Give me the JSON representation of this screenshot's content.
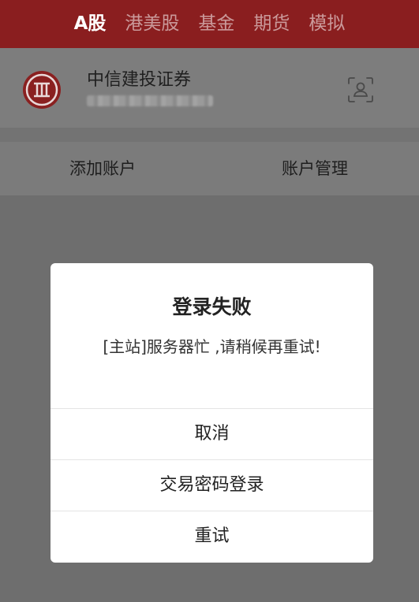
{
  "tabs": [
    {
      "label": "A股",
      "active": true
    },
    {
      "label": "港美股",
      "active": false
    },
    {
      "label": "基金",
      "active": false
    },
    {
      "label": "期货",
      "active": false
    },
    {
      "label": "模拟",
      "active": false
    }
  ],
  "account": {
    "broker_name": "中信建投证券",
    "logo_icon": "citic-logo-icon",
    "face_id_icon": "face-id-icon"
  },
  "actions": {
    "add_label": "添加账户",
    "manage_label": "账户管理"
  },
  "dialog": {
    "title": "登录失败",
    "message": "[主站]服务器忙 ,请稍候再重试!",
    "buttons": [
      "取消",
      "交易密码登录",
      "重试"
    ]
  },
  "colors": {
    "brand_red": "#8a1e1f",
    "overlay": "#6e6e6e",
    "dialog_bg": "#ffffff"
  }
}
